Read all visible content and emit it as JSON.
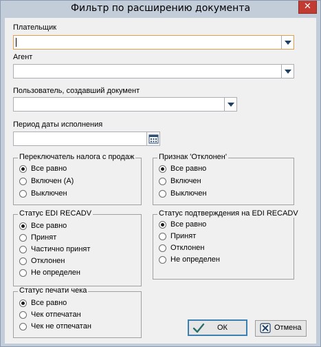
{
  "window": {
    "title": "Фильтр по расширению документа",
    "close_glyph": "✕"
  },
  "fields": {
    "payer": {
      "label": "Плательщик",
      "value": ""
    },
    "agent": {
      "label": "Агент",
      "value": ""
    },
    "creator": {
      "label": "Пользователь, создавший документ",
      "value": ""
    },
    "period": {
      "label": "Период даты исполнения",
      "value": ""
    }
  },
  "groups": {
    "tax_switch": {
      "title": "Переключатель налога с продаж",
      "options": [
        "Все равно",
        "Включен (А)",
        "Выключен"
      ],
      "selected": 0
    },
    "rejected": {
      "title": "Признак 'Отклонен'",
      "options": [
        "Все равно",
        "Включен",
        "Выключен"
      ],
      "selected": 0
    },
    "edi_recadv": {
      "title": "Статус EDI RECADV",
      "options": [
        "Все равно",
        "Принят",
        "Частично принят",
        "Отклонен",
        "Не определен"
      ],
      "selected": 0
    },
    "edi_confirm": {
      "title": "Статус подтверждения на EDI RECADV",
      "options": [
        "Все равно",
        "Принят",
        "Отклонен",
        "Не определен"
      ],
      "selected": 0
    },
    "receipt_print": {
      "title": "Статус печати чека",
      "options": [
        "Все равно",
        "Чек отпечатан",
        "Чек не отпечатан"
      ],
      "selected": 0
    }
  },
  "buttons": {
    "ok": "ОК",
    "cancel": "Отмена"
  },
  "icons": {
    "close": "close-icon",
    "dropdown": "chevron-down-icon",
    "calendar": "calendar-icon",
    "ok": "checkmark-icon",
    "cancel": "cancel-icon"
  },
  "colors": {
    "window_frame": "#c3ccd9",
    "client_bg": "#f0f0f0",
    "close_button": "#c23b32",
    "focus_border": "#e0a04a",
    "default_button_border": "#3c7fb1",
    "ok_check": "#2a6e6a",
    "cancel_x": "#1e3f66"
  }
}
